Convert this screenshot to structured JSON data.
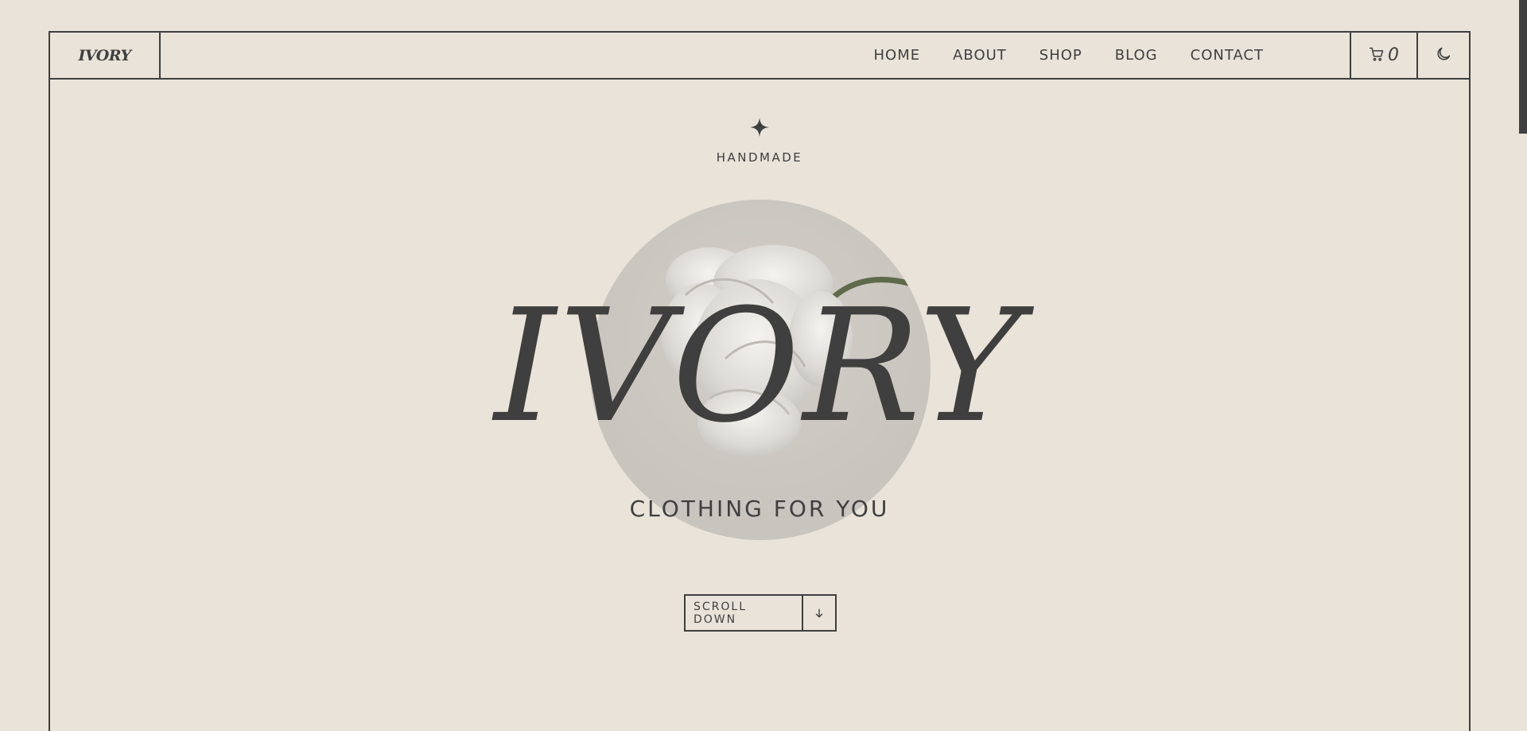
{
  "brand": {
    "logo": "IVORY"
  },
  "nav": {
    "items": [
      "HOME",
      "ABOUT",
      "SHOP",
      "BLOG",
      "CONTACT"
    ]
  },
  "cart": {
    "icon": "cart-icon",
    "count": "0"
  },
  "theme_toggle": {
    "icon": "moon-icon"
  },
  "hero": {
    "sparkle_icon": "sparkle-icon",
    "eyebrow": "HANDMADE",
    "title": "IVORY",
    "subtitle": "CLOTHING FOR YOU",
    "image": "white-flower-image"
  },
  "scroll": {
    "label": "SCROLL DOWN",
    "icon": "arrow-down-icon"
  },
  "colors": {
    "background": "#eae3d9",
    "ink": "#3f3f3f",
    "circle": "#c9c5bf"
  }
}
